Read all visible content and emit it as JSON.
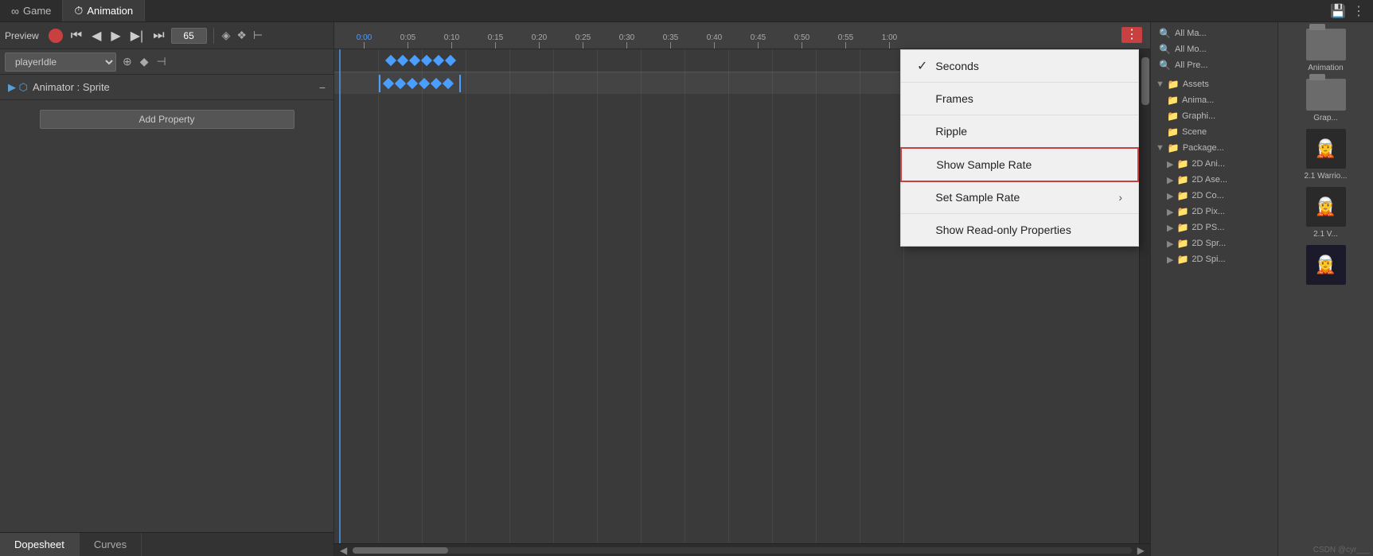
{
  "tabs": {
    "game": {
      "label": "Game",
      "icon": "∞"
    },
    "animation": {
      "label": "Animation",
      "icon": "⏱"
    }
  },
  "toolbar": {
    "preview_label": "Preview",
    "frame_value": "65",
    "playhead_time": "0:00"
  },
  "animator": {
    "label": "Animator : Sprite",
    "add_property_label": "Add Property"
  },
  "dropdown_select": {
    "selected": "playerIdle"
  },
  "timeline": {
    "ruler_marks": [
      "0:00",
      "0:05",
      "0:10",
      "0:15",
      "0:20",
      "0:25",
      "0:30",
      "0:35",
      "0:40",
      "0:45",
      "0:50",
      "0:55",
      "1:00"
    ]
  },
  "context_menu": {
    "items": [
      {
        "id": "seconds",
        "label": "Seconds",
        "checked": true,
        "has_arrow": false
      },
      {
        "id": "frames",
        "label": "Frames",
        "checked": false,
        "has_arrow": false
      },
      {
        "id": "ripple",
        "label": "Ripple",
        "checked": false,
        "has_arrow": false
      },
      {
        "id": "show-sample-rate",
        "label": "Show Sample Rate",
        "checked": false,
        "has_arrow": false,
        "highlighted": true
      },
      {
        "id": "set-sample-rate",
        "label": "Set Sample Rate",
        "checked": false,
        "has_arrow": true
      },
      {
        "id": "show-readonly",
        "label": "Show Read-only Properties",
        "checked": false,
        "has_arrow": false
      }
    ]
  },
  "right_panel": {
    "search_items": [
      {
        "label": "All Ma..."
      },
      {
        "label": "All Mo..."
      },
      {
        "label": "All Pre..."
      }
    ],
    "assets_label": "Assets",
    "folders": [
      {
        "label": "Anima..."
      },
      {
        "label": "Graphi..."
      },
      {
        "label": "Scene"
      }
    ],
    "packages_label": "Package...",
    "packages": [
      {
        "label": "2D Ani..."
      },
      {
        "label": "2D Ase..."
      },
      {
        "label": "2D Co..."
      },
      {
        "label": "2D Pix..."
      },
      {
        "label": "2D PS..."
      },
      {
        "label": "2D Spr..."
      },
      {
        "label": "2D Spi..."
      }
    ]
  },
  "far_right": {
    "items": [
      {
        "type": "folder",
        "label": "Animation"
      },
      {
        "type": "folder",
        "label": "Grap..."
      },
      {
        "type": "sprite",
        "label": "2.1 Warrio..."
      },
      {
        "type": "sprite2",
        "label": "2.1 V..."
      },
      {
        "type": "sprite3",
        "label": ""
      },
      {
        "type": "sprite4",
        "label": ""
      }
    ]
  },
  "bottom_tabs": {
    "dopesheet": "Dopesheet",
    "curves": "Curves"
  },
  "watermark": "CSDN @cyr___"
}
